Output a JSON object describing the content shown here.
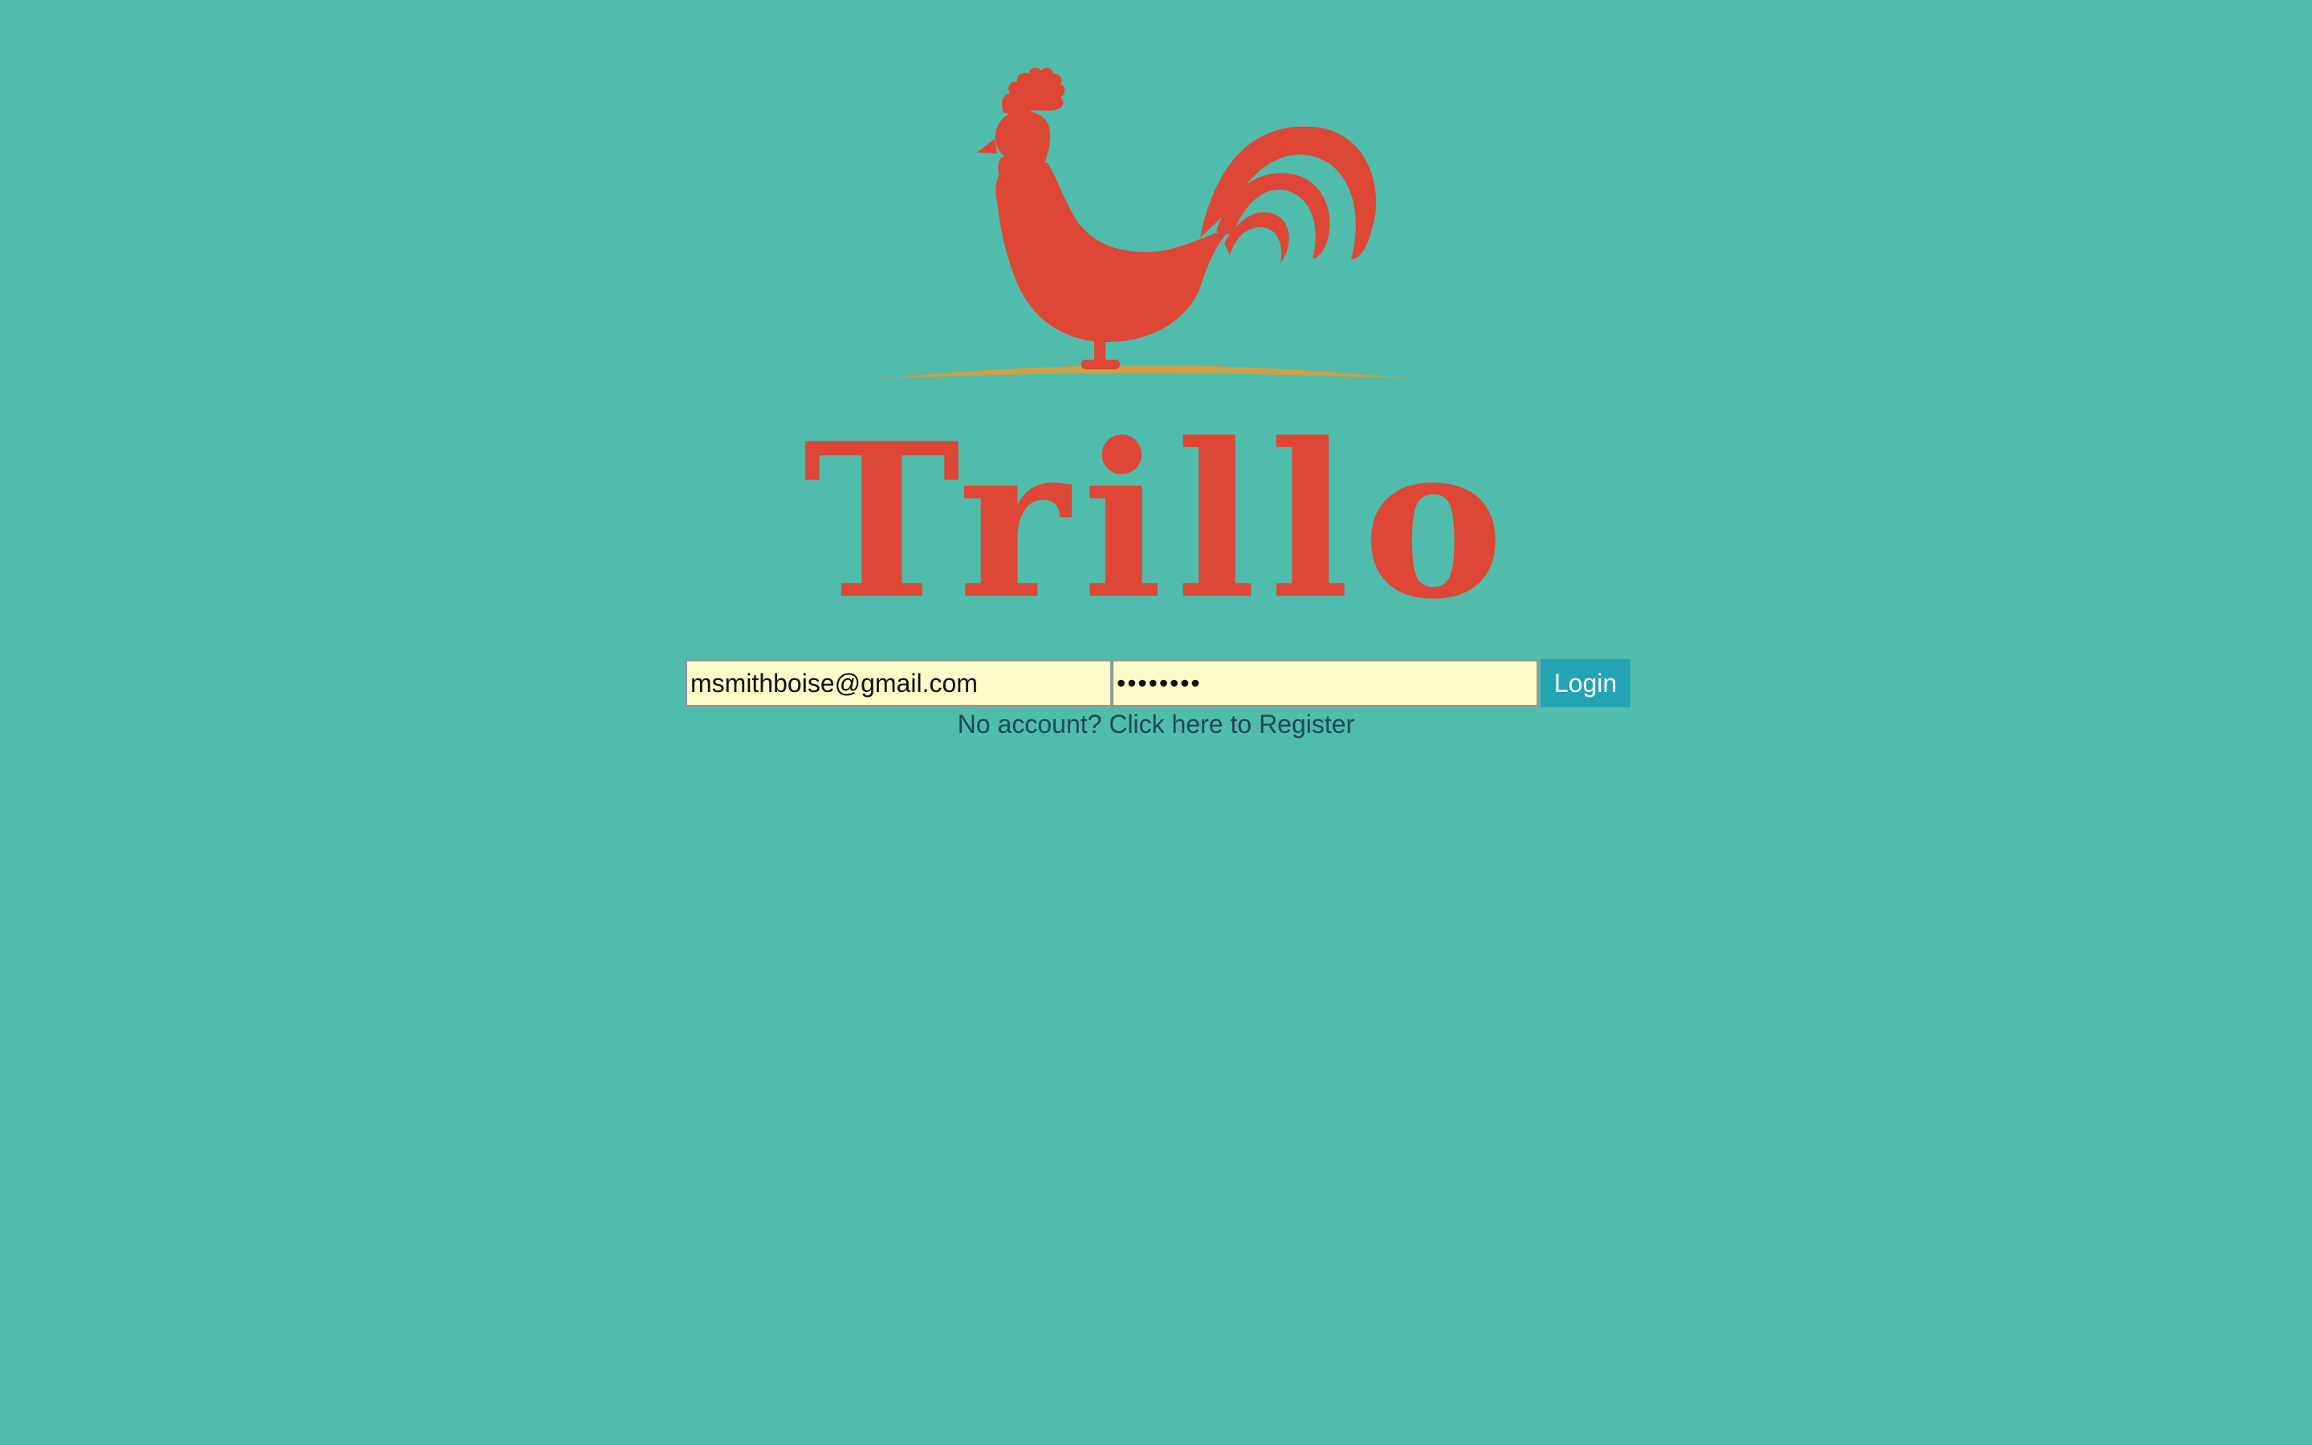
{
  "app": {
    "name": "Trillo",
    "logo_icon": "rooster-icon"
  },
  "login": {
    "email_value": "msmithboise@gmail.com",
    "password_value": "password",
    "button_label": "Login",
    "register_link": "No account? Click here to Register"
  },
  "colors": {
    "background": "#50bcab",
    "brand": "#de4635",
    "ground": "#caa24a",
    "input_bg": "#fbfcc7",
    "button": "#24a3b5",
    "link": "#1e4b56"
  }
}
